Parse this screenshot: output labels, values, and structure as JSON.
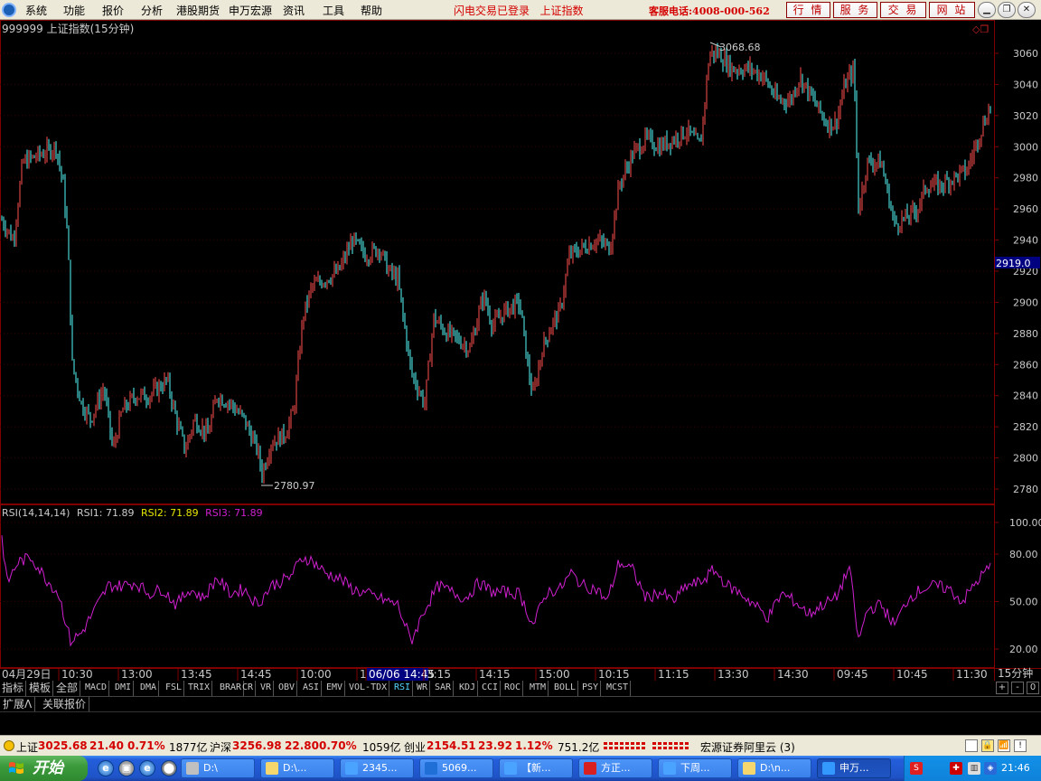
{
  "menubar": {
    "items": [
      "系统",
      "功能",
      "报价",
      "分析",
      "港股期货",
      "申万宏源",
      "资讯",
      "工具",
      "帮助"
    ],
    "login_status": "闪电交易已登录",
    "index_name": "上证指数",
    "hotline": "客服电话:4008-000-562",
    "buttons": [
      "行 情",
      "服 务",
      "交 易",
      "网 站"
    ],
    "window_controls": [
      "minimize-icon",
      "restore-icon",
      "close-icon"
    ]
  },
  "main_chart": {
    "header": "999999 上证指数(15分钟)",
    "high_label": "3068.68",
    "low_label": "2780.97",
    "current_price": "2919.0",
    "y_ticks": [
      "3060",
      "3040",
      "3020",
      "3000",
      "2980",
      "2960",
      "2940",
      "2920",
      "2900",
      "2880",
      "2860",
      "2840",
      "2820",
      "2800",
      "2780"
    ]
  },
  "rsi_panel": {
    "label": "RSI(14,14,14)",
    "rsi1": "RSI1: 71.89",
    "rsi2": "RSI2: 71.89",
    "rsi3": "RSI3: 71.89",
    "y_ticks": [
      "100.00",
      "80.00",
      "50.00",
      "20.00"
    ]
  },
  "time_axis": {
    "labels": [
      "04月29日",
      "10:30",
      "13:00",
      "13:45",
      "14:45",
      "10:00",
      "1",
      "06/06 14:45",
      "3:15",
      "14:15",
      "15:00",
      "10:15",
      "11:15",
      "13:30",
      "14:30",
      "09:45",
      "10:45",
      "11:30"
    ],
    "period": "15分钟"
  },
  "indicator_tabs": [
    "指标",
    "模板",
    "全部",
    "MACD",
    "DMI",
    "DMA",
    "FSL",
    "TRIX",
    "BRAR",
    "CR",
    "VR",
    "OBV",
    "ASI",
    "EMV",
    "VOL-TDX",
    "RSI",
    "WR",
    "SAR",
    "KDJ",
    "CCI",
    "ROC",
    "MTM",
    "BOLL",
    "PSY",
    "MCST"
  ],
  "active_tab": "RSI",
  "tab_nav": [
    "+",
    "-",
    "0"
  ],
  "ext_tabs": [
    "扩展Λ",
    "关联报价"
  ],
  "statusbar": {
    "sh_label": "上证",
    "sh_value": "3025.68",
    "sh_change": "21.40",
    "sh_pct": "0.71%",
    "sh_volume": "1877亿",
    "hs_label": "沪深",
    "hs_value": "3256.98",
    "hs_change": "22.80",
    "hs_pct": "0.70%",
    "hs_volume": "1059亿",
    "cy_label": "创业",
    "cy_value": "2154.51",
    "cy_change": "23.92",
    "cy_pct": "1.12%",
    "cy_volume": "751.2亿",
    "broker": "宏源证券阿里云 (3)"
  },
  "taskbar": {
    "start_label": "开始",
    "tasks": [
      {
        "label": "D:\\",
        "icon": "drive-icon"
      },
      {
        "label": "D:\\...",
        "icon": "folder-icon"
      },
      {
        "label": "2345...",
        "icon": "ie-icon"
      },
      {
        "label": "5069...",
        "icon": "app-z-icon"
      },
      {
        "label": "【新...",
        "icon": "ie-icon"
      },
      {
        "label": "方正...",
        "icon": "app-red-icon"
      },
      {
        "label": "下周...",
        "icon": "ie-icon"
      },
      {
        "label": "D:\\n...",
        "icon": "folder-icon"
      },
      {
        "label": "申万...",
        "icon": "app-blue-icon"
      }
    ],
    "clock": "21:46"
  },
  "colors": {
    "up": "#ff5050",
    "down": "#54fcfc",
    "rsi": "#d020d0",
    "grid": "#800000",
    "axis_text": "#c8c8c8",
    "accent_red": "#d40000"
  }
}
